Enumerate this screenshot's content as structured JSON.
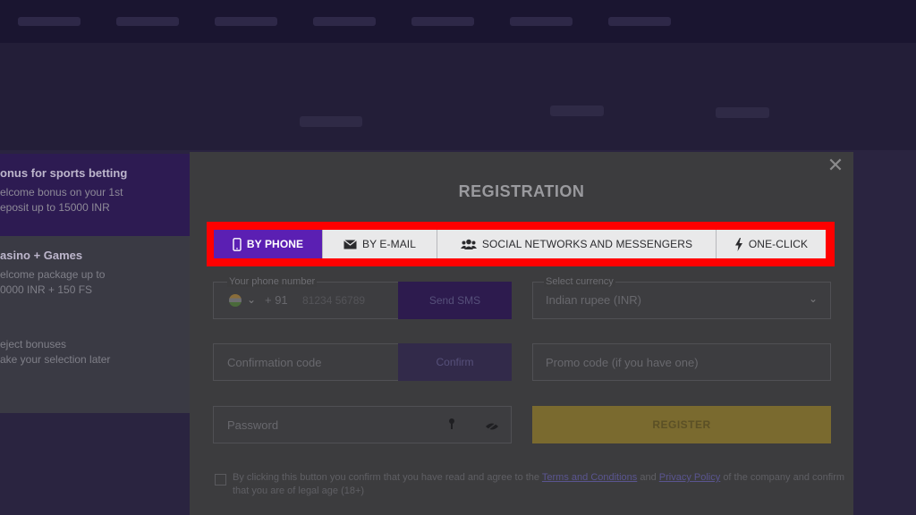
{
  "modal": {
    "title": "REGISTRATION",
    "close_glyph": "✕"
  },
  "tabs": [
    {
      "label": "BY PHONE",
      "icon": "phone-icon",
      "active": true
    },
    {
      "label": "BY E-MAIL",
      "icon": "envelope-icon",
      "active": false
    },
    {
      "label": "SOCIAL NETWORKS AND MESSENGERS",
      "icon": "users-icon",
      "active": false
    },
    {
      "label": "ONE-CLICK",
      "icon": "lightning-icon",
      "active": false
    }
  ],
  "form": {
    "phone_label": "Your phone number",
    "phone_code": "+ 91",
    "phone_placeholder": "81234 56789",
    "send_sms": "Send SMS",
    "currency_label": "Select currency",
    "currency_value": "Indian rupee (INR)",
    "confirmation_placeholder": "Confirmation code",
    "confirm": "Confirm",
    "promo_placeholder": "Promo code (if you have one)",
    "password_placeholder": "Password",
    "register": "REGISTER",
    "consent_prefix": "By clicking this button you confirm that you have read and agree to the",
    "terms_link": "Terms and Conditions",
    "consent_and": "and",
    "privacy_link": "Privacy Policy",
    "consent_suffix": "of the company and confirm that you are of legal age (18+)"
  },
  "bonuses": {
    "sports_title": "onus for sports betting",
    "sports_line1": "elcome bonus on your 1st",
    "sports_line2": "eposit up to 15000 INR",
    "casino_title": "asino + Games",
    "casino_line1": "elcome package up to",
    "casino_line2": "0000 INR + 150 FS",
    "reject_title": "eject bonuses",
    "reject_line": "ake your selection later"
  },
  "colors": {
    "active_tab": "#5b1fb3",
    "highlight": "#ff0000",
    "register": "#7a6a2f"
  }
}
